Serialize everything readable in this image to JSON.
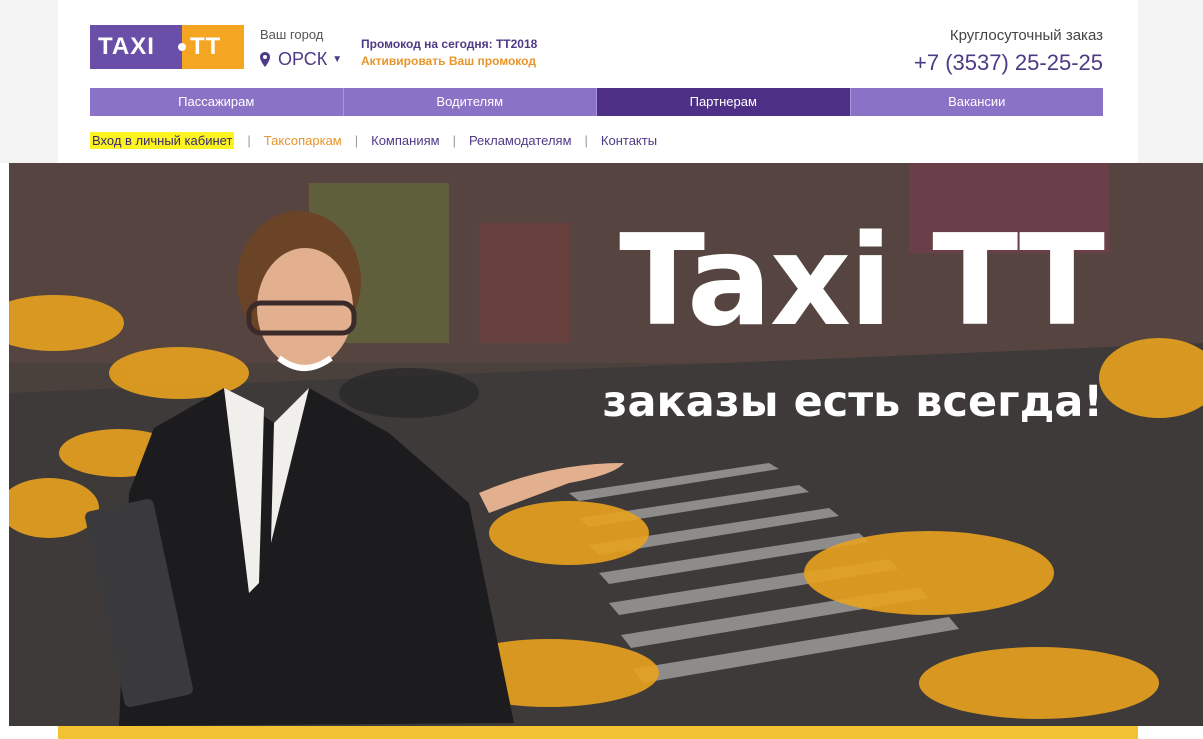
{
  "header": {
    "logo": {
      "left": "TAXI",
      "right": "TT"
    },
    "city_label": "Ваш город",
    "city_value": "ОРСК",
    "promo_text": "Промокод на сегодня: TT2018",
    "promo_link": "Активировать Ваш промокод",
    "order_label": "Круглосуточный заказ",
    "order_phone": "+7 (3537) 25-25-25"
  },
  "main_nav": {
    "tabs": [
      {
        "label": "Пассажирам",
        "active": false
      },
      {
        "label": "Водителям",
        "active": false
      },
      {
        "label": "Партнерам",
        "active": true
      },
      {
        "label": "Вакансии",
        "active": false
      }
    ]
  },
  "sub_nav": {
    "items": [
      {
        "label": "Вход в личный кабинет"
      },
      {
        "label": "Таксопаркам"
      },
      {
        "label": "Компаниям"
      },
      {
        "label": "Рекламодателям"
      },
      {
        "label": "Контакты"
      }
    ]
  },
  "hero": {
    "title": "Taxi TT",
    "subtitle": "заказы есть всегда!"
  },
  "colors": {
    "brand_purple": "#4d2f86",
    "nav_purple": "#8a72c7",
    "brand_orange": "#f4a623",
    "highlight_yellow": "#fcf421"
  }
}
